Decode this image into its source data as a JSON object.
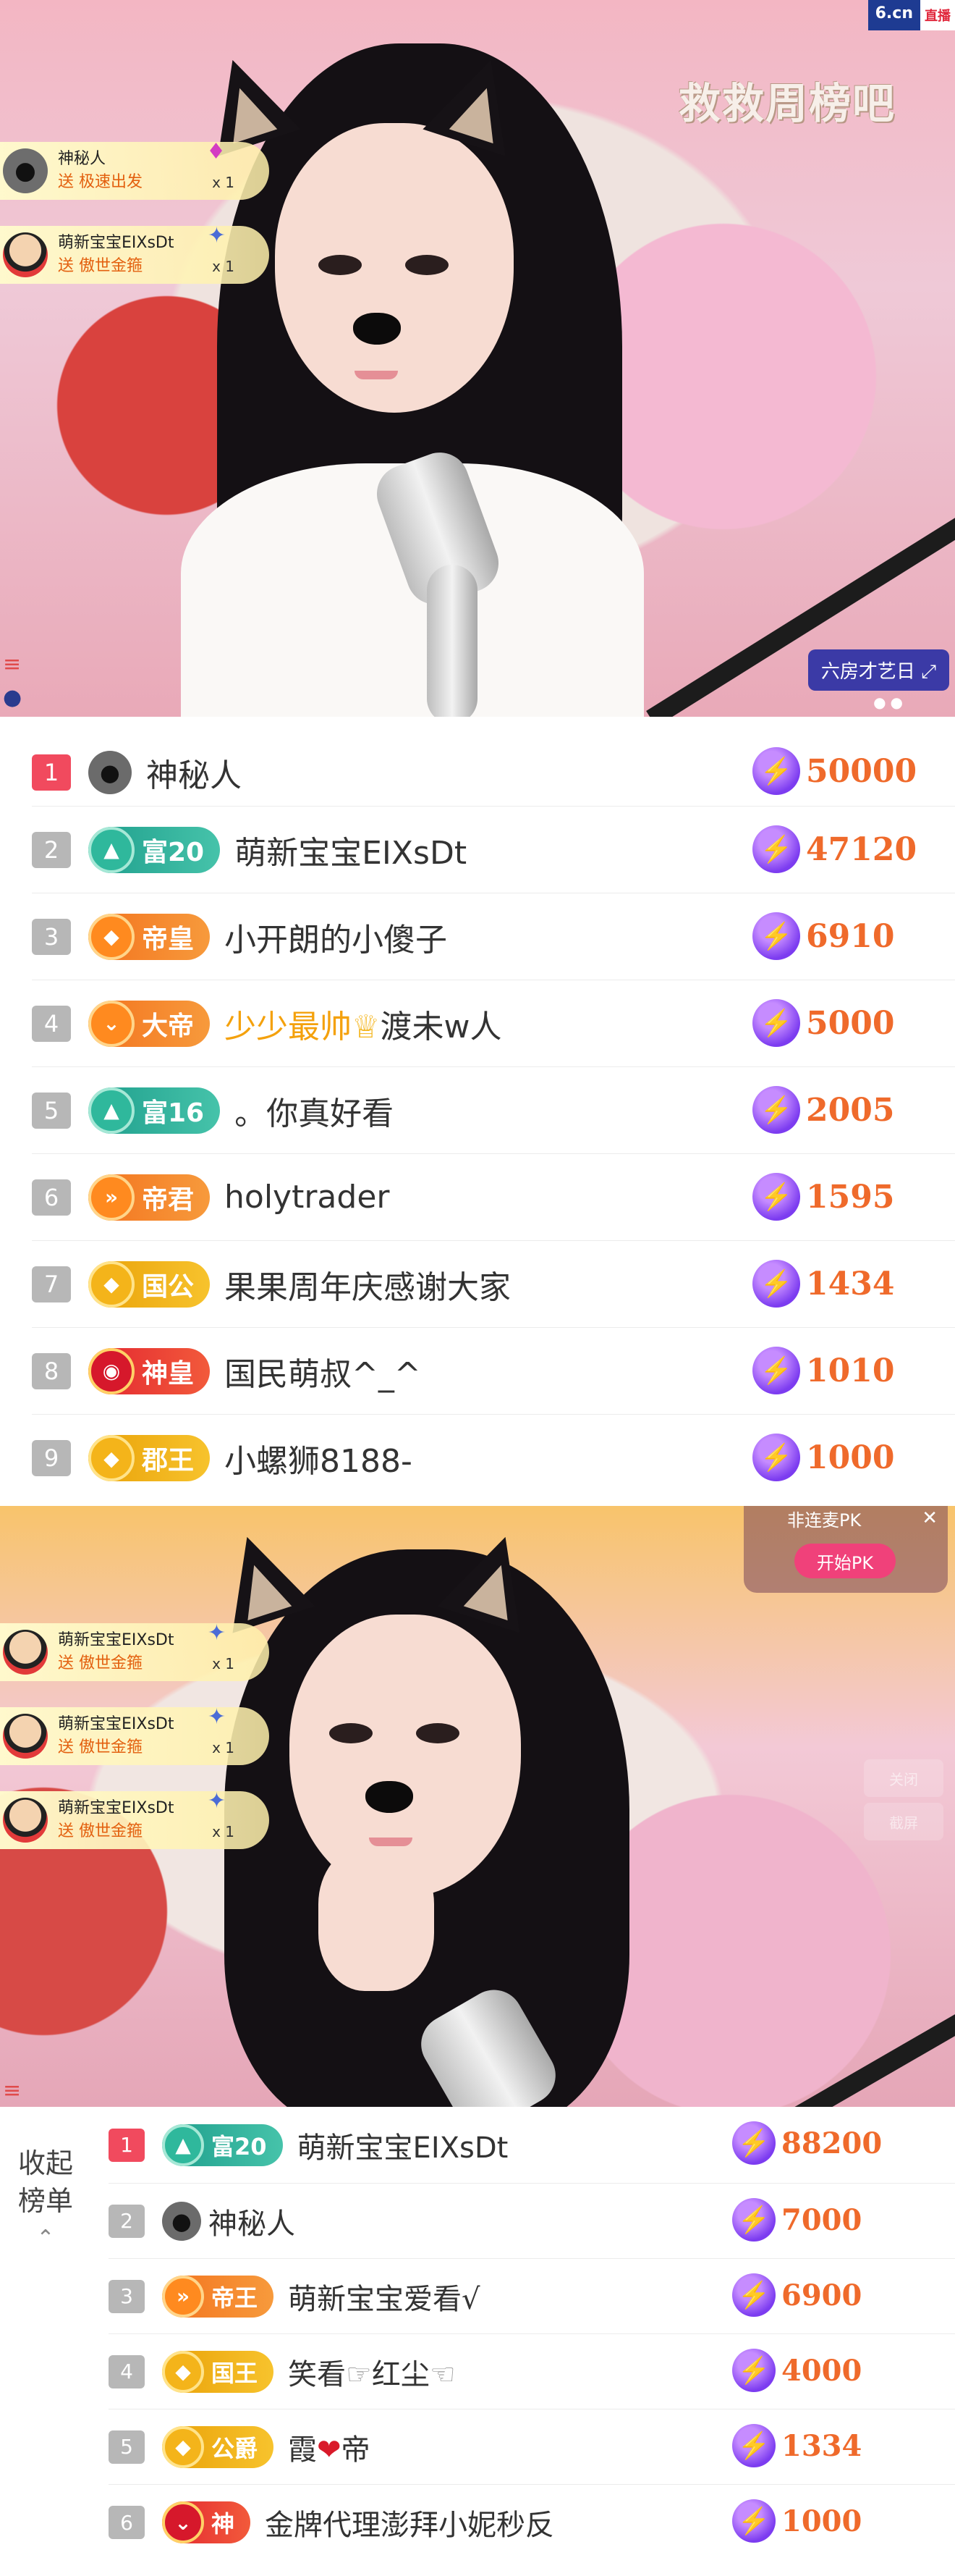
{
  "stream1": {
    "logo_left": "6.cn",
    "logo_right": "直播",
    "promo_text": "救救周榜吧",
    "room_badge": "六房才艺日",
    "gifts": [
      {
        "user": "神秘人",
        "action": "送 极速出发",
        "count": "x 1"
      },
      {
        "user": "萌新宝宝EIXsDt",
        "action": "送 傲世金箍",
        "count": "x 1"
      }
    ]
  },
  "list1": {
    "rows": [
      {
        "rank": "1",
        "name": "神秘人",
        "badge": "",
        "score": "50000"
      },
      {
        "rank": "2",
        "name": "萌新宝宝EIXsDt",
        "badge": "富20",
        "score": "47120"
      },
      {
        "rank": "3",
        "name": "小开朗的小傻子",
        "badge": "帝皇",
        "score": "6910"
      },
      {
        "rank": "4",
        "name_gold": "少少最帅",
        "name": "渡未w人",
        "badge": "大帝",
        "score": "5000"
      },
      {
        "rank": "5",
        "name": "。你真好看",
        "badge": "富16",
        "score": "2005"
      },
      {
        "rank": "6",
        "name": "holytrader",
        "badge": "帝君",
        "score": "1595"
      },
      {
        "rank": "7",
        "name": "果果周年庆感谢大家",
        "badge": "国公",
        "score": "1434"
      },
      {
        "rank": "8",
        "name": "国民萌叔^_^",
        "badge": "神皇",
        "score": "1010"
      },
      {
        "rank": "9",
        "name": "小螺狮8188-",
        "badge": "郡王",
        "score": "1000"
      }
    ]
  },
  "stream2": {
    "pk_title": "非连麦PK",
    "pk_button": "开始PK",
    "faint1": "关闭",
    "faint2": "截屏",
    "gifts": [
      {
        "user": "萌新宝宝EIXsDt",
        "action": "送 傲世金箍",
        "count": "x 1"
      },
      {
        "user": "萌新宝宝EIXsDt",
        "action": "送 傲世金箍",
        "count": "x 1"
      },
      {
        "user": "萌新宝宝EIXsDt",
        "action": "送 傲世金箍",
        "count": "x 1"
      }
    ]
  },
  "list2": {
    "collapse_label_1": "收起",
    "collapse_label_2": "榜单",
    "rows": [
      {
        "rank": "1",
        "name": "萌新宝宝EIXsDt",
        "badge": "富20",
        "score": "88200"
      },
      {
        "rank": "2",
        "name": "神秘人",
        "badge": "",
        "score": "7000"
      },
      {
        "rank": "3",
        "name": "萌新宝宝爱看√",
        "badge": "帝王",
        "score": "6900"
      },
      {
        "rank": "4",
        "name": "笑看",
        "name2": "红尘",
        "badge": "国王",
        "score": "4000"
      },
      {
        "rank": "5",
        "name": "霞",
        "name2": "帝",
        "badge": "公爵",
        "score": "1334"
      },
      {
        "rank": "6",
        "name": "金牌代理澎拜小妮秒反",
        "badge": "神",
        "score": "1000"
      }
    ]
  },
  "colors": {
    "accent": "#ef6a2b",
    "rank_first": "#f14a5e",
    "rank_other": "#b7b7b7"
  }
}
